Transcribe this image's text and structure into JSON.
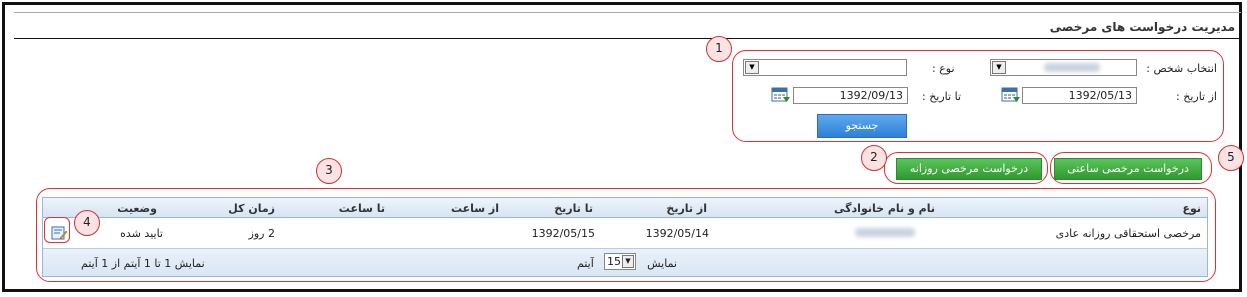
{
  "page": {
    "title": "مدیریت درخواست های مرخصی"
  },
  "filters": {
    "person_label": "انتخاب شخص :",
    "type_label": "نوع :",
    "from_date_label": "از تاریخ :",
    "to_date_label": "تا تاریخ :",
    "from_date_value": "1392/05/13",
    "to_date_value": "1392/09/13",
    "search_button": "جستجو"
  },
  "actions": {
    "daily_leave_button": "درخواست مرخصی روزانه",
    "hourly_leave_button": "درخواست مرخصی ساعتی"
  },
  "grid": {
    "columns": [
      "نوع",
      "نام و نام خانوادگی",
      "از تاریخ",
      "تا تاریخ",
      "از ساعت",
      "تا ساعت",
      "زمان کل",
      "وضعیت"
    ],
    "rows": [
      {
        "type": "مرخصی استحقاقی روزانه عادی",
        "from_date": "1392/05/14",
        "to_date": "1392/05/15",
        "from_time": "",
        "to_time": "",
        "total": "2 روز",
        "status": "تایید شده"
      }
    ],
    "footer": {
      "page_size_label": "نمایش",
      "page_size_value": "15",
      "items_label": "آیتم",
      "summary": "نمایش 1 تا 1 آیتم از 1 آیتم"
    }
  },
  "callouts": [
    "1",
    "2",
    "3",
    "4",
    "5"
  ],
  "colors": {
    "annotation_red": "#d33333",
    "green_button": "#2f9a2f",
    "blue_button": "#2f80d6"
  }
}
